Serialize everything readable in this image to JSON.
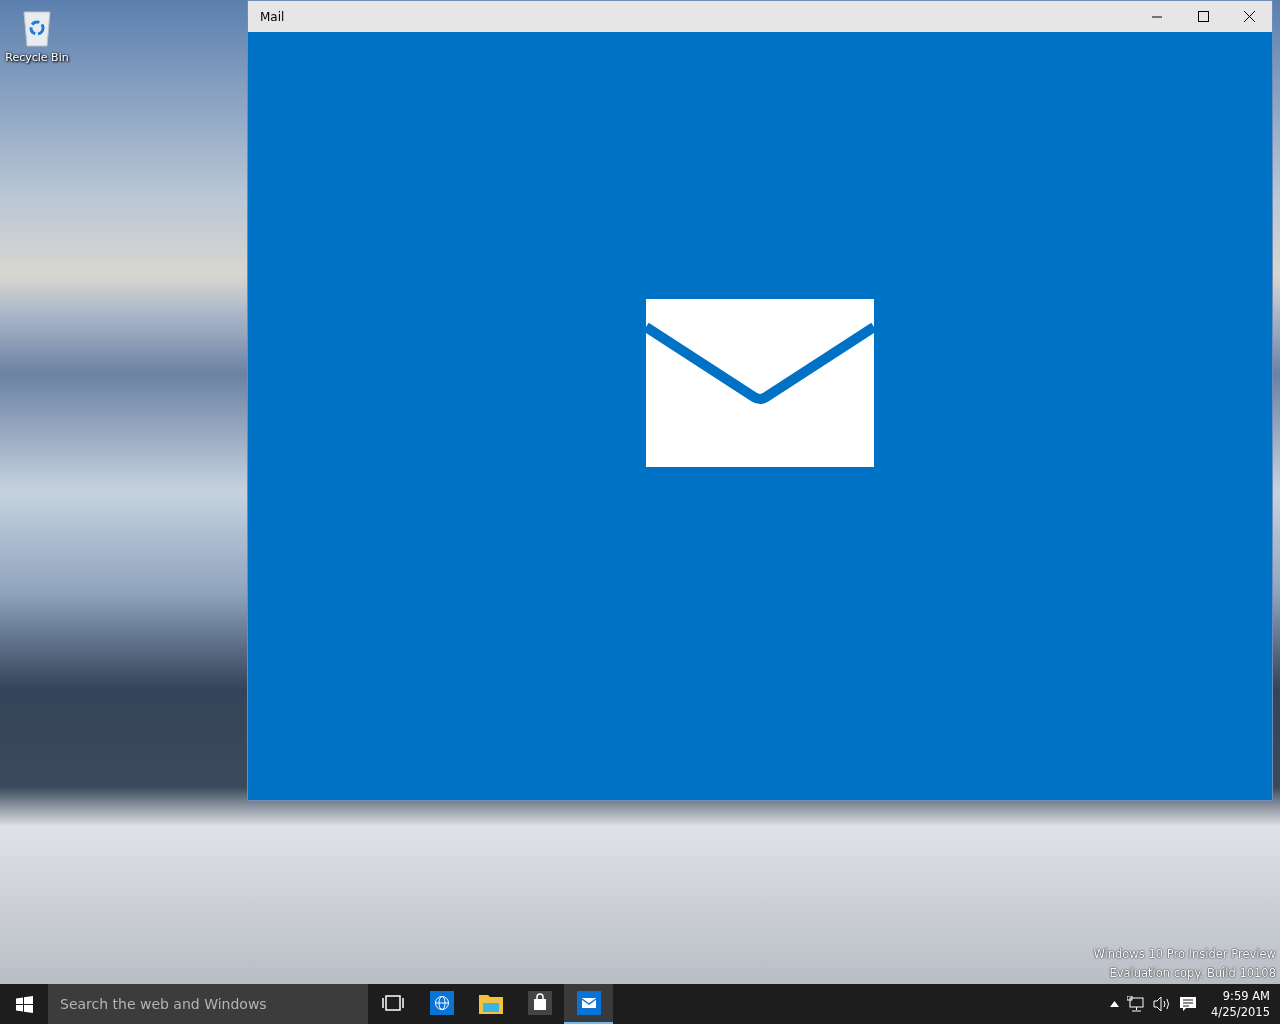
{
  "desktop": {
    "icons": [
      {
        "label": "Recycle Bin"
      }
    ],
    "edition_lines": [
      "Windows 10 Pro Insider Preview",
      "Evaluation copy. Build 10108"
    ]
  },
  "window": {
    "title": "Mail"
  },
  "taskbar": {
    "search": {
      "placeholder": "Search the web and Windows"
    },
    "apps": [
      {
        "kind": "taskview",
        "active": false
      },
      {
        "kind": "browser",
        "active": false
      },
      {
        "kind": "folder",
        "active": false
      },
      {
        "kind": "store",
        "active": false
      },
      {
        "kind": "mail",
        "active": true
      }
    ],
    "clock": {
      "time": "9:59 AM",
      "date": "4/25/2015"
    }
  }
}
